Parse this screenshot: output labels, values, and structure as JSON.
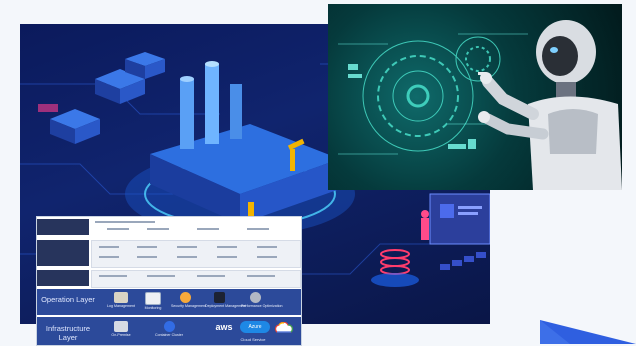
{
  "colors": {
    "factory_bg": "#0b1a5c",
    "robot_bg": "#053a3c",
    "layer_blue": "#2c4a9a",
    "header_navy": "#27345c",
    "accent_blue": "#2f5fe0"
  },
  "architecture": {
    "operation_layer": {
      "label": "Operation Layer",
      "items": [
        {
          "icon": "log-management-icon",
          "caption": "Log Management"
        },
        {
          "icon": "monitoring-icon",
          "caption": "Monitoring"
        },
        {
          "icon": "security-management-icon",
          "caption": "Security Management"
        },
        {
          "icon": "deployment-management-icon",
          "caption": "Deployment Management"
        },
        {
          "icon": "performance-optimization-icon",
          "caption": "Performance Optimization"
        }
      ]
    },
    "infrastructure_layer": {
      "label": "Infrastructure Layer",
      "items": [
        {
          "icon": "on-premise-icon",
          "caption": "On-Premise"
        },
        {
          "icon": "container-cluster-icon",
          "caption": "Container Cluster"
        },
        {
          "icon": "aws-logo",
          "caption": "aws"
        },
        {
          "icon": "azure-logo",
          "caption": "Azure"
        },
        {
          "icon": "google-cloud-logo",
          "caption": ""
        }
      ],
      "cloud_caption": "Cloud Service"
    }
  }
}
